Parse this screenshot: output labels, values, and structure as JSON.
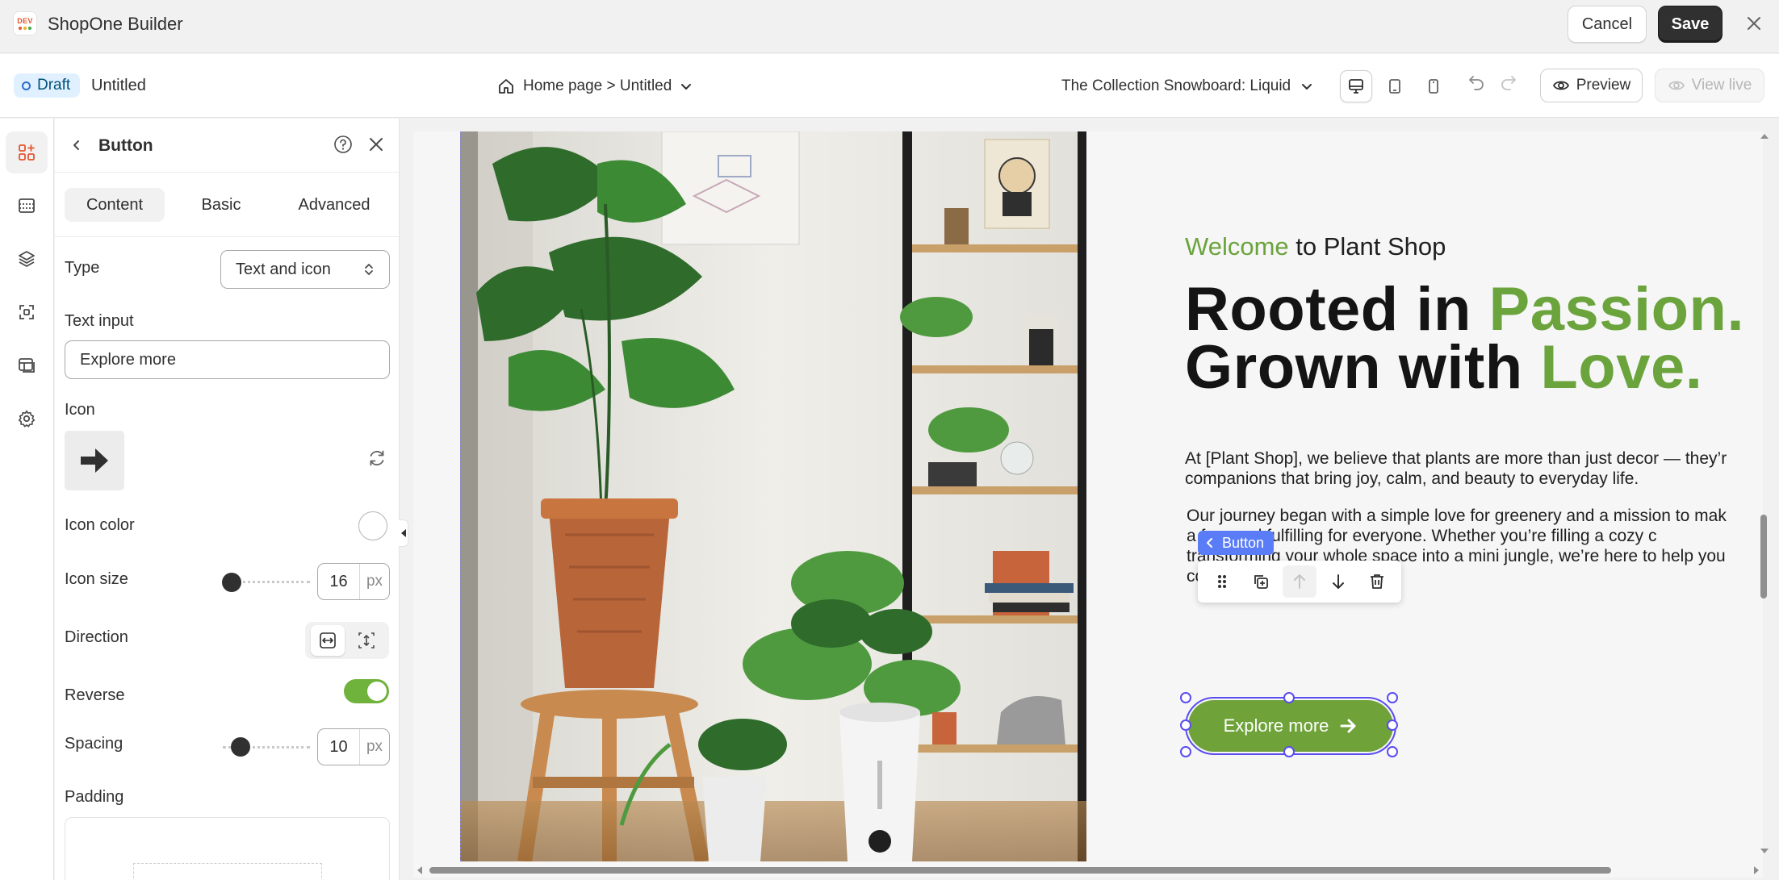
{
  "app": {
    "logo_text": "DEV",
    "title": "ShopOne Builder",
    "cancel_label": "Cancel",
    "save_label": "Save"
  },
  "subbar": {
    "status_badge": "Draft",
    "page_name": "Untitled",
    "page_path": "Home page > Untitled",
    "template": "The Collection Snowboard: Liquid",
    "preview_label": "Preview",
    "view_live_label": "View live"
  },
  "panel": {
    "title": "Button",
    "tabs": [
      "Content",
      "Basic",
      "Advanced"
    ],
    "active_tab": "Content",
    "type_label": "Type",
    "type_value": "Text and icon",
    "text_input_label": "Text input",
    "text_input_value": "Explore more",
    "icon_label": "Icon",
    "icon_name": "arrow-right-icon",
    "icon_color_label": "Icon color",
    "icon_color_value": "#ffffff",
    "icon_size_label": "Icon size",
    "icon_size_value": "16",
    "icon_size_unit": "px",
    "direction_label": "Direction",
    "direction_value": "horizontal",
    "reverse_label": "Reverse",
    "reverse_on": true,
    "spacing_label": "Spacing",
    "spacing_value": "10",
    "spacing_unit": "px",
    "padding_label": "Padding"
  },
  "canvas": {
    "welcome_accent": "Welcome",
    "welcome_rest": " to Plant Shop",
    "headline_line1_a": "Rooted in ",
    "headline_line1_b": "Passion.",
    "headline_line2_a": "Grown with ",
    "headline_line2_b": "Love.",
    "para1_line1": "At [Plant Shop], we believe that plants are more than just decor — they’r",
    "para1_line2": "companions that bring joy, calm, and beauty to everyday life.",
    "para2_line1": "Our journey began with a simple love for greenery and a mission to mak",
    "para2_line2": "a       fun, and fulfilling for everyone. Whether you’re filling a cozy c",
    "para2_line3": "transforming your whole space into a mini jungle, we’re here to help you",
    "para2_line4": "co",
    "selected_tag": "Button",
    "button_label": "Explore more"
  },
  "colors": {
    "accent_green": "#6ba33c",
    "selection_purple": "#5a4df0",
    "tag_blue": "#5a7cf6",
    "dark_button": "#303030"
  }
}
